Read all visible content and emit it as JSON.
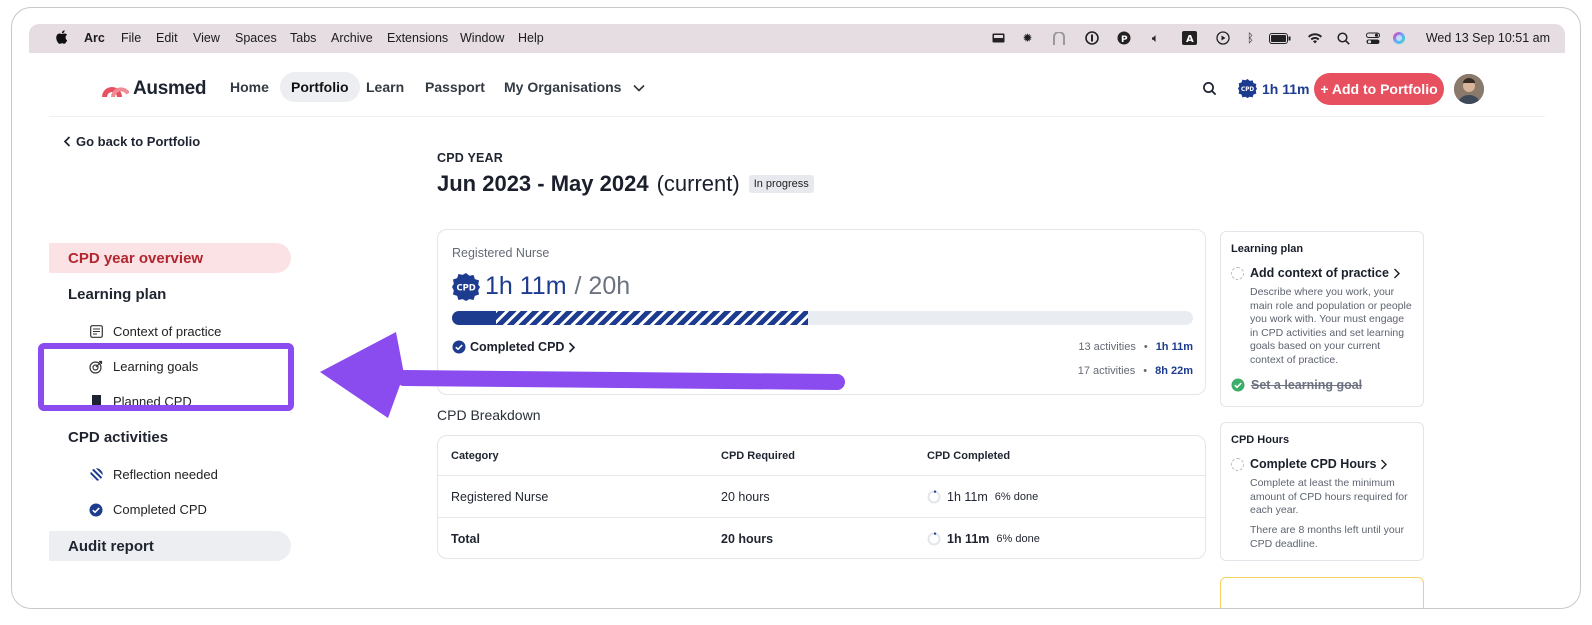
{
  "menubar": {
    "app": "Arc",
    "menus": [
      "File",
      "Edit",
      "View",
      "Spaces",
      "Tabs",
      "Archive",
      "Extensions",
      "Window",
      "Help"
    ],
    "clock": "Wed 13 Sep  10:51 am",
    "status_icons": [
      "display-icon",
      "gear-icon",
      "arch-icon",
      "onepassword-icon",
      "p-icon",
      "volume-icon",
      "keyboard-a-icon",
      "play-icon",
      "bluetooth-icon",
      "battery-icon",
      "wifi-icon",
      "search-icon",
      "control-center-icon",
      "siri-icon"
    ]
  },
  "nav": {
    "brand": "Ausmed",
    "links": [
      "Home",
      "Portfolio",
      "Learn",
      "Passport",
      "My Organisations"
    ],
    "active": "Portfolio",
    "cpd_total": "1h 11m",
    "cpd_badge": "CPD",
    "add_button": "+ Add to Portfolio"
  },
  "sidebar": {
    "back": "Go back to Portfolio",
    "overview": "CPD year overview",
    "learning_plan": "Learning plan",
    "learning_items": [
      "Context of practice",
      "Learning goals",
      "Planned CPD"
    ],
    "cpd_activities": "CPD activities",
    "activity_items": [
      "Reflection needed",
      "Completed CPD"
    ],
    "audit": "Audit report"
  },
  "main": {
    "year_label": "CPD YEAR",
    "year_range": "Jun 2023 - May 2024",
    "year_current": "(current)",
    "year_status": "In progress",
    "progress": {
      "role": "Registered Nurse",
      "badge": "CPD",
      "completed": "1h 11m",
      "target": "/ 20h",
      "completed_fraction": 0.06,
      "planned_fraction": 0.48,
      "completed_label": "Completed CPD",
      "completed_activities": "13 activities",
      "completed_time": "1h 11m",
      "second_activities": "17 activities",
      "second_time": "8h 22m",
      "bullet": "•"
    },
    "breakdown": {
      "title": "CPD Breakdown",
      "headers": [
        "Category",
        "CPD Required",
        "CPD Completed"
      ],
      "rows": [
        {
          "category": "Registered Nurse",
          "required": "20 hours",
          "completed": "1h 11m",
          "pct": "6% done"
        },
        {
          "category": "Total",
          "required": "20 hours",
          "completed": "1h 11m",
          "pct": "6% done"
        }
      ]
    }
  },
  "right": {
    "plan_card": {
      "title": "Learning plan",
      "action": "Add context of practice",
      "desc": "Describe where you work, your main role and population or people you work with. Your must engage in CPD activities and set learning goals based on your current context of practice.",
      "done": "Set a learning goal"
    },
    "hours_card": {
      "title": "CPD Hours",
      "action": "Complete CPD Hours",
      "desc": "Complete at least the minimum amount of CPD hours required for each year.",
      "desc2": "There are 8 months left until your CPD deadline."
    }
  },
  "colors": {
    "accent": "#b3262f",
    "brand_blue": "#1d3b8f",
    "add_button": "#e6505f",
    "annotation": "#8a4bef"
  }
}
